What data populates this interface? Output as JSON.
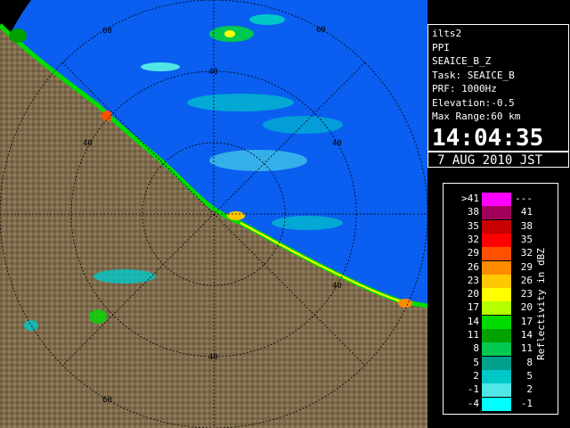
{
  "radar": {
    "range_labels": {
      "ring60_top": "60",
      "ring60_right": "60",
      "ring60_bottom": "60",
      "ring40_top": "40",
      "ring40_left": "40",
      "ring40_right": "40",
      "ring40_right_lower": "40",
      "ring40_bottom": "40"
    },
    "colors": {
      "sea": "#0a5ef0",
      "land": "#7d6a4c",
      "background": "#000000"
    }
  },
  "info": {
    "station": "ilts2",
    "mode": "PPI",
    "product": "SEAICE_B_Z",
    "task": "Task: SEAICE_B",
    "prf": "PRF: 1000Hz",
    "elevation": "Elevation:-0.5",
    "max_range": "Max Range:60 km",
    "time": "14:04:35",
    "date": "7 AUG 2010 JST"
  },
  "legend": {
    "caption": "Reflectivity in dBZ",
    "rows": [
      {
        "lo": ">41",
        "hi": "---",
        "color": "#ff00ff"
      },
      {
        "lo": "38",
        "hi": "41",
        "color": "#a0005a"
      },
      {
        "lo": "35",
        "hi": "38",
        "color": "#c80000"
      },
      {
        "lo": "32",
        "hi": "35",
        "color": "#ff0000"
      },
      {
        "lo": "29",
        "hi": "32",
        "color": "#ff5000"
      },
      {
        "lo": "26",
        "hi": "29",
        "color": "#ff8c00"
      },
      {
        "lo": "23",
        "hi": "26",
        "color": "#ffc800"
      },
      {
        "lo": "20",
        "hi": "23",
        "color": "#ffff00"
      },
      {
        "lo": "17",
        "hi": "20",
        "color": "#b4ff00"
      },
      {
        "lo": "14",
        "hi": "17",
        "color": "#00dc00"
      },
      {
        "lo": "11",
        "hi": "14",
        "color": "#00a000"
      },
      {
        "lo": "8",
        "hi": "11",
        "color": "#00c850"
      },
      {
        "lo": "5",
        "hi": "8",
        "color": "#00a08c"
      },
      {
        "lo": "2",
        "hi": "5",
        "color": "#00c8c8"
      },
      {
        "lo": "-1",
        "hi": "2",
        "color": "#50e6e6"
      },
      {
        "lo": "-4",
        "hi": "-1",
        "color": "#00ffff"
      }
    ]
  }
}
